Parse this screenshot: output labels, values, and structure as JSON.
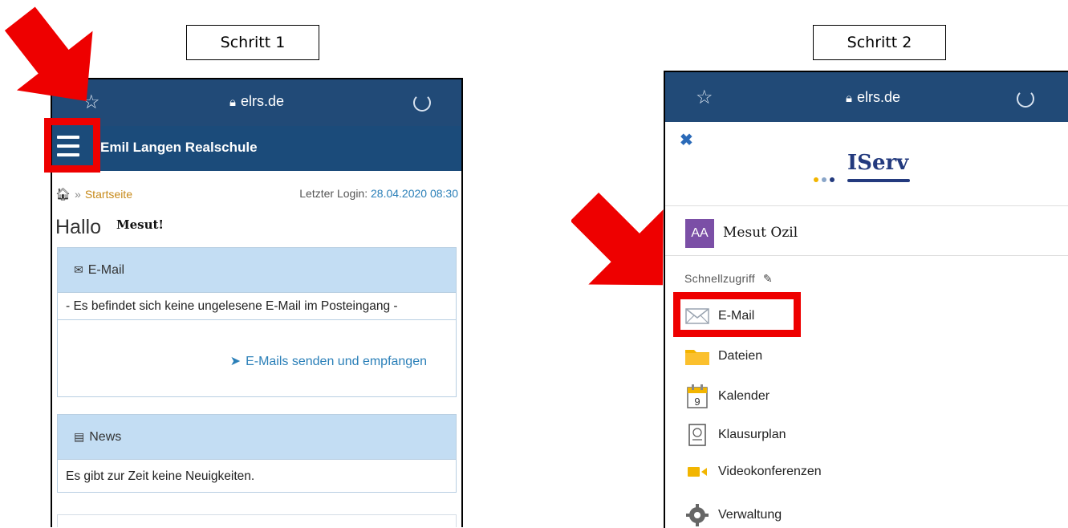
{
  "steps": {
    "step1": "Schritt 1",
    "step2": "Schritt 2"
  },
  "colors": {
    "highlight_red": "#ee0000",
    "browser_bar": "#214a77",
    "panel_head": "#c3ddf3",
    "link_blue": "#2a7fb8",
    "avatar_purple": "#7b4fa6"
  },
  "left": {
    "browser": {
      "url": "elrs.de",
      "star_icon": "star-outline-icon",
      "reload_icon": "reload-icon",
      "lock_icon": "lock-icon"
    },
    "school_title": "Emil Langen Realschule",
    "breadcrumb": {
      "separator": "»",
      "current": "Startseite"
    },
    "last_login": {
      "label": "Letzter Login:",
      "value": "28.04.2020 08:30"
    },
    "greeting": "Hallo",
    "name": "Mesut!",
    "email_panel": {
      "title": "E-Mail",
      "message": "- Es befindet sich keine ungelesene E-Mail im Posteingang -",
      "action": "E-Mails senden und empfangen"
    },
    "news_panel": {
      "title": "News",
      "message": "Es gibt zur Zeit keine Neuigkeiten."
    }
  },
  "right": {
    "browser": {
      "url": "elrs.de"
    },
    "logo_text": "IServ",
    "avatar_initials": "AA",
    "user_name": "Mesut Ozil",
    "quick_access": "Schnellzugriff",
    "menu": [
      {
        "label": "E-Mail",
        "icon": "envelope-icon"
      },
      {
        "label": "Dateien",
        "icon": "folder-icon"
      },
      {
        "label": "Kalender",
        "icon": "calendar-icon",
        "icon_text": "9"
      },
      {
        "label": "Klausurplan",
        "icon": "exam-plan-icon"
      },
      {
        "label": "Videokonferenzen",
        "icon": "video-icon"
      },
      {
        "label": "Verwaltung",
        "icon": "gear-icon"
      }
    ]
  }
}
